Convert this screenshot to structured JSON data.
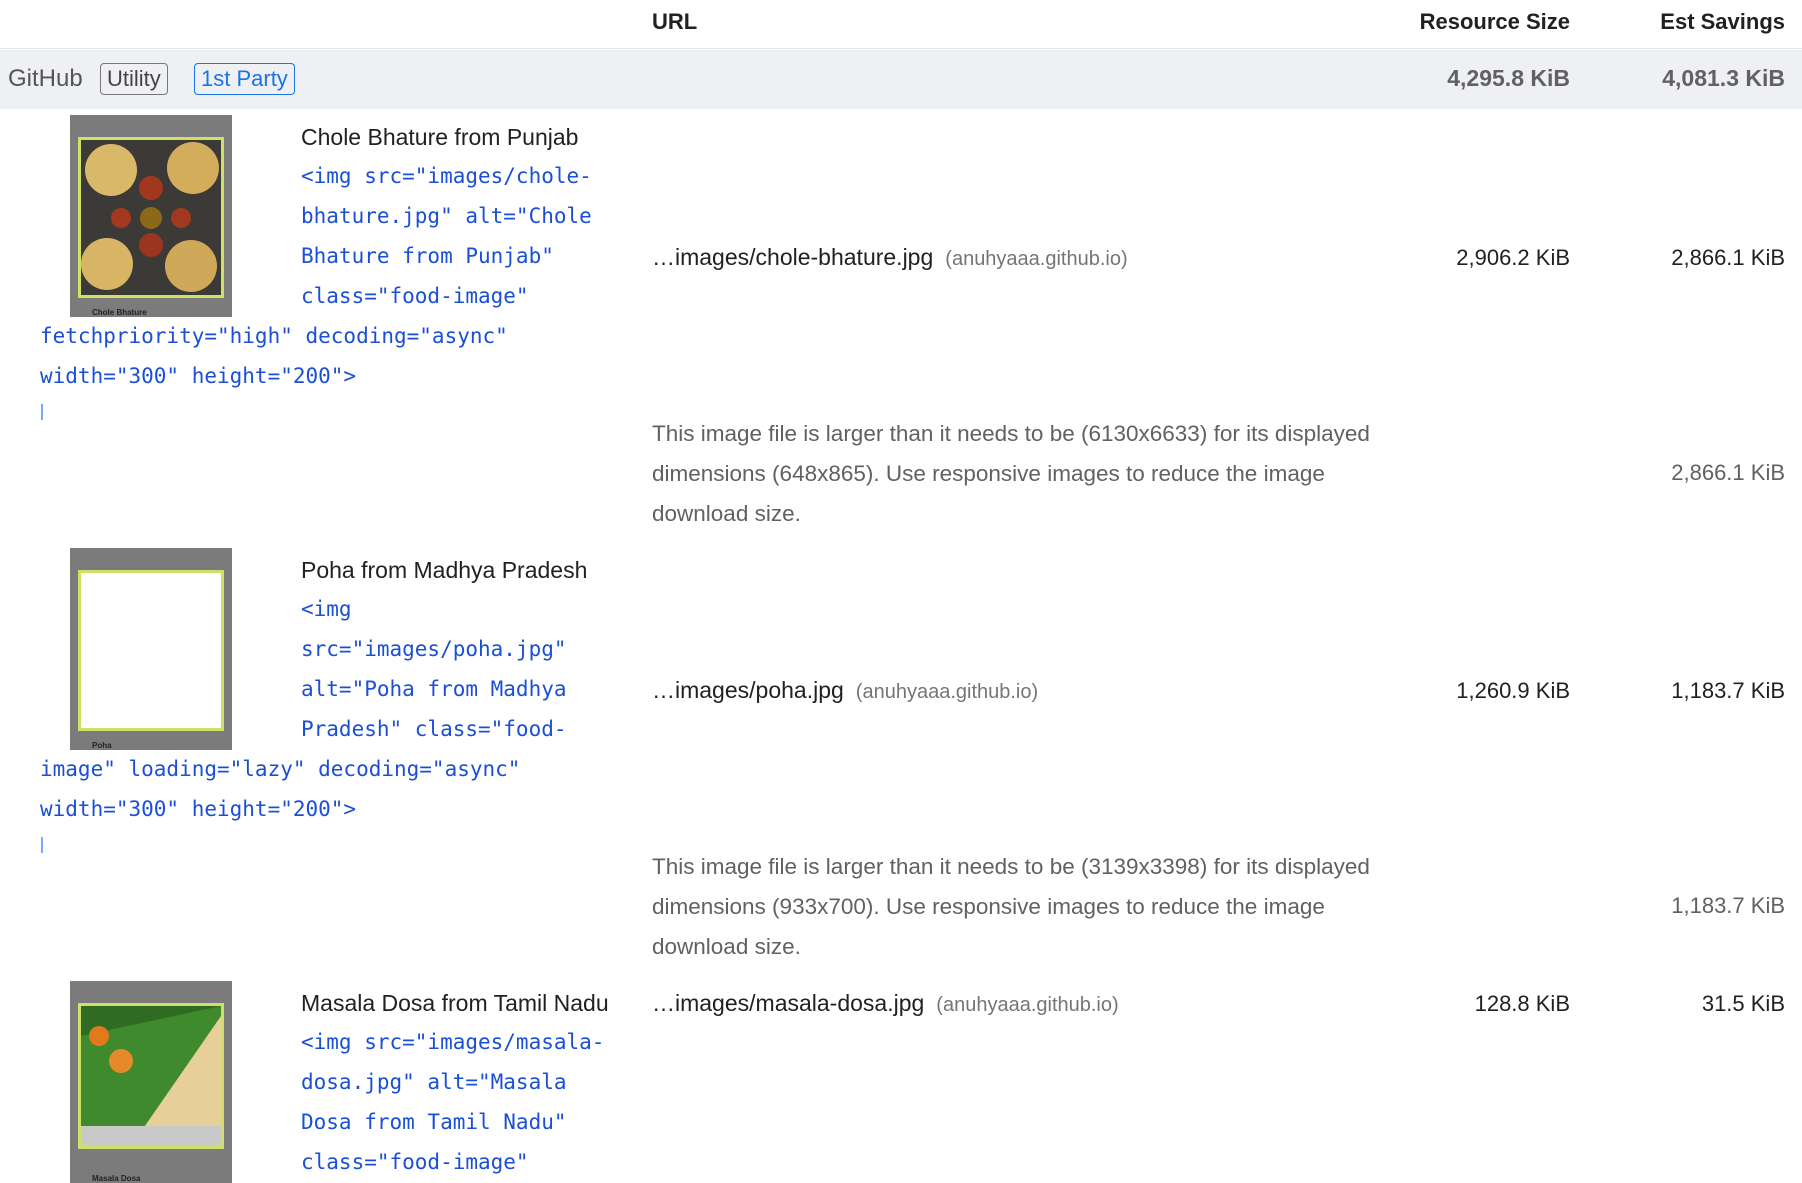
{
  "header": {
    "url": "URL",
    "resource_size": "Resource Size",
    "est_savings": "Est Savings"
  },
  "group": {
    "name": "GitHub",
    "badge_utility": "Utility",
    "badge_party": "1st Party",
    "resource_size": "4,295.8 KiB",
    "est_savings": "4,081.3 KiB"
  },
  "rows": [
    {
      "title": "Chole Bhature from Punjab",
      "thumb_caption": "Chole Bhature",
      "code_a": "<img src=\"images/chole-\nbhature.jpg\" alt=\"Chole\nBhature from Punjab\"\nclass=\"food-image\"",
      "code_b": "fetchpriority=\"high\" decoding=\"async\"\nwidth=\"300\" height=\"200\">",
      "url": "…images/chole-bhature.jpg",
      "host": "(anuhyaaa.github.io)",
      "resource_size": "2,906.2 KiB",
      "est_savings": "2,866.1 KiB",
      "message": "This image file is larger than it needs to be (6130x6633) for its displayed dimensions (648x865). Use responsive images to reduce the image download size.",
      "message_savings": "2,866.1 KiB"
    },
    {
      "title": "Poha from Madhya Pradesh",
      "thumb_caption": "Poha",
      "code_a": "<img\nsrc=\"images/poha.jpg\"\nalt=\"Poha from Madhya\nPradesh\" class=\"food-",
      "code_b": "image\" loading=\"lazy\" decoding=\"async\"\nwidth=\"300\" height=\"200\">",
      "url": "…images/poha.jpg",
      "host": "(anuhyaaa.github.io)",
      "resource_size": "1,260.9 KiB",
      "est_savings": "1,183.7 KiB",
      "message": "This image file is larger than it needs to be (3139x3398) for its displayed dimensions (933x700). Use responsive images to reduce the image download size.",
      "message_savings": "1,183.7 KiB"
    },
    {
      "title": "Masala Dosa from Tamil Nadu",
      "thumb_caption": "Masala Dosa",
      "code_a": "<img src=\"images/masala-\ndosa.jpg\" alt=\"Masala\nDosa from Tamil Nadu\"\nclass=\"food-image\"",
      "url": "…images/masala-dosa.jpg",
      "host": "(anuhyaaa.github.io)",
      "resource_size": "128.8 KiB",
      "est_savings": "31.5 KiB"
    }
  ]
}
